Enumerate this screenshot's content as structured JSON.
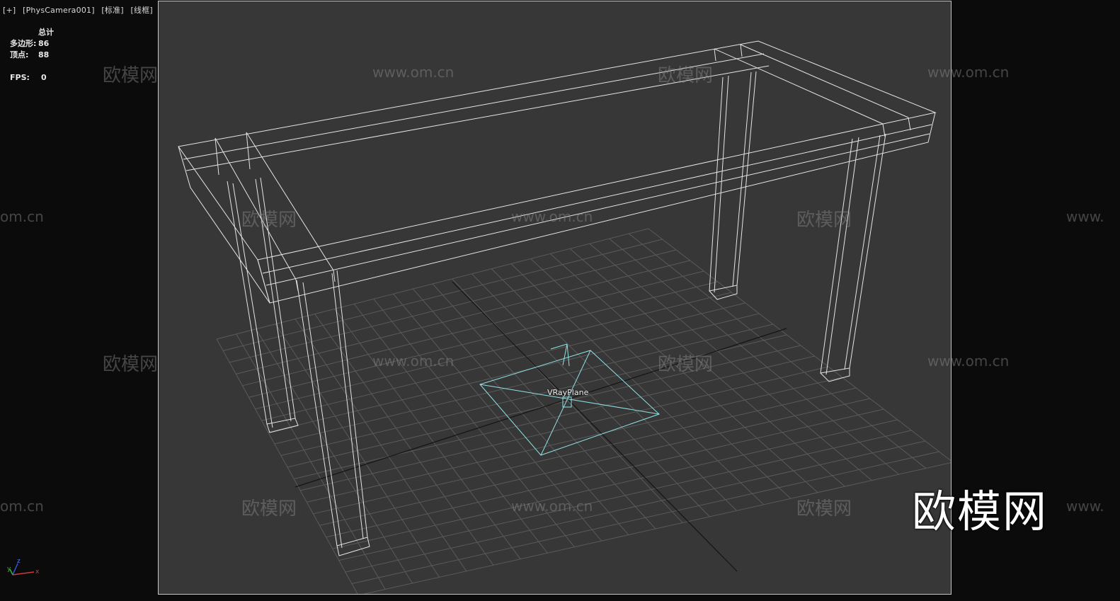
{
  "viewport_label": {
    "plus": "[+]",
    "camera": "[PhysCamera001]",
    "shading": "[标准]",
    "mode": "[线框]"
  },
  "stats": {
    "header": "总计",
    "polygons_label": "多边形:",
    "polygons_value": "86",
    "vertices_label": "顶点:",
    "vertices_value": "88",
    "fps_label": "FPS:",
    "fps_value": "0"
  },
  "scene": {
    "object_label": "VRayPlane",
    "grid_color": "#5a5a5a",
    "axis_color": "#111111",
    "wire_color": "#e6e6e6",
    "plane_color": "#8fe3e6"
  },
  "axis_gizmo": {
    "x": "x",
    "y": "y",
    "z": "z"
  },
  "watermarks": {
    "cn": "欧模网",
    "url": "www.om.cn",
    "url_fragment_left": "om.cn",
    "url_fragment_right": "www."
  },
  "logo": "欧模网"
}
